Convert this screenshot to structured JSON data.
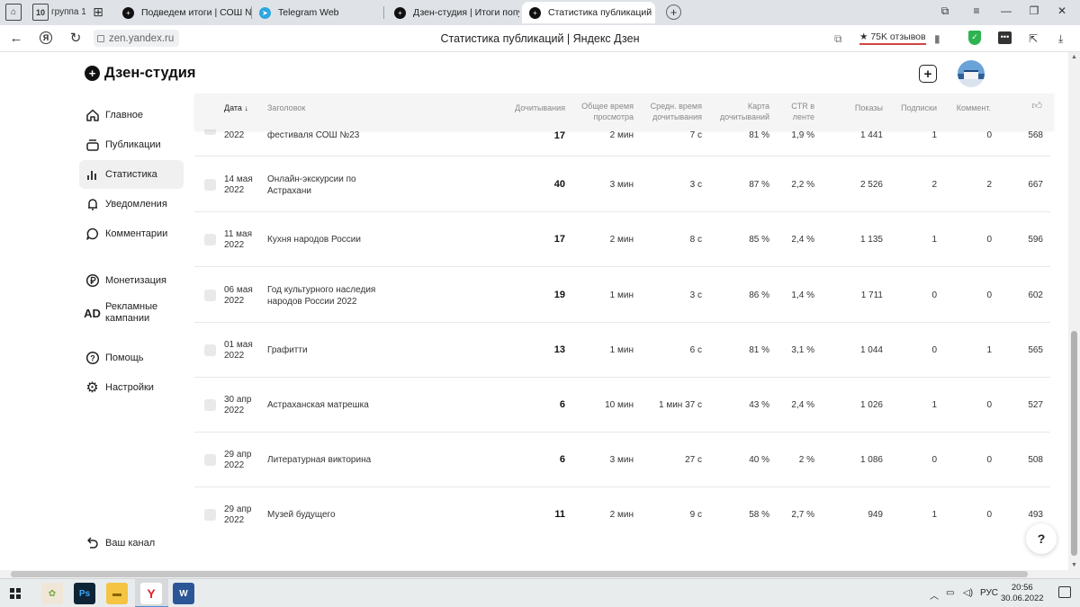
{
  "tabstrip": {
    "tab_count": "10",
    "group_label": "группа 1",
    "tabs": [
      {
        "title": "Подведем итоги | СОШ №",
        "favicon": "zen-icon"
      },
      {
        "title": "Telegram Web",
        "favicon": "telegram-icon"
      },
      {
        "title": "Дзен-студия | Итоги попул",
        "favicon": "zen-icon"
      },
      {
        "title": "Статистика публикаций",
        "favicon": "zen-icon"
      }
    ]
  },
  "addressbar": {
    "url": "zen.yandex.ru",
    "page_title": "Статистика публикаций | Яндекс Дзен",
    "reviews": "★ 75K отзывов"
  },
  "header": {
    "logo_text": "Дзен-студия"
  },
  "sidebar": {
    "items": [
      {
        "label": "Главное",
        "icon": "home-icon"
      },
      {
        "label": "Публикации",
        "icon": "publications-icon"
      },
      {
        "label": "Статистика",
        "icon": "stats-icon"
      },
      {
        "label": "Уведомления",
        "icon": "bell-icon"
      },
      {
        "label": "Комментарии",
        "icon": "comment-icon"
      },
      {
        "label": "Монетизация",
        "icon": "ruble-icon"
      },
      {
        "label": "Рекламные кампании",
        "icon": "ad-icon"
      },
      {
        "label": "Помощь",
        "icon": "help-icon"
      },
      {
        "label": "Настройки",
        "icon": "gear-icon"
      }
    ],
    "channel_label": "Ваш канал"
  },
  "table": {
    "headers": {
      "date": "Дата",
      "title": "Заголовок",
      "reads": "Дочитывания",
      "total_time": "Общее время просмотра",
      "avg_time": "Средн. время дочитывания",
      "map": "Карта дочитываний",
      "ctr": "CTR в ленте",
      "views": "Показы",
      "subs": "Подписки",
      "comments": "Коммент."
    },
    "partial_row": {
      "date": "2022",
      "title": "фестиваля СОШ №23",
      "reads": "17",
      "total_time": "2 мин",
      "avg_time": "7 с",
      "map": "81 %",
      "ctr": "1,9 %",
      "views": "1 441",
      "subs": "1",
      "comments": "0",
      "likes": "568"
    },
    "rows": [
      {
        "date1": "14 мая",
        "date2": "2022",
        "title1": "Онлайн-экскурсии по",
        "title2": "Астрахани",
        "reads": "40",
        "total_time": "3 мин",
        "avg_time": "3 с",
        "map": "87 %",
        "ctr": "2,2 %",
        "views": "2 526",
        "subs": "2",
        "comments": "2",
        "likes": "667"
      },
      {
        "date1": "11 мая",
        "date2": "2022",
        "title1": "Кухня народов России",
        "title2": "",
        "reads": "17",
        "total_time": "2 мин",
        "avg_time": "8 с",
        "map": "85 %",
        "ctr": "2,4 %",
        "views": "1 135",
        "subs": "1",
        "comments": "0",
        "likes": "596"
      },
      {
        "date1": "06 мая",
        "date2": "2022",
        "title1": "Год культурного наследия",
        "title2": "народов России 2022",
        "reads": "19",
        "total_time": "1 мин",
        "avg_time": "3 с",
        "map": "86 %",
        "ctr": "1,4 %",
        "views": "1 711",
        "subs": "0",
        "comments": "0",
        "likes": "602"
      },
      {
        "date1": "01 мая",
        "date2": "2022",
        "title1": "Графитти",
        "title2": "",
        "reads": "13",
        "total_time": "1 мин",
        "avg_time": "6 с",
        "map": "81 %",
        "ctr": "3,1 %",
        "views": "1 044",
        "subs": "0",
        "comments": "1",
        "likes": "565"
      },
      {
        "date1": "30 апр",
        "date2": "2022",
        "title1": "Астраханская матрешка",
        "title2": "",
        "reads": "6",
        "total_time": "10 мин",
        "avg_time": "1 мин 37 с",
        "map": "43 %",
        "ctr": "2,4 %",
        "views": "1 026",
        "subs": "1",
        "comments": "0",
        "likes": "527"
      },
      {
        "date1": "29 апр",
        "date2": "2022",
        "title1": "Литературная викторина",
        "title2": "",
        "reads": "6",
        "total_time": "3 мин",
        "avg_time": "27 с",
        "map": "40 %",
        "ctr": "2 %",
        "views": "1 086",
        "subs": "0",
        "comments": "0",
        "likes": "508"
      },
      {
        "date1": "29 апр",
        "date2": "2022",
        "title1": "Музей будущего",
        "title2": "",
        "reads": "11",
        "total_time": "2 мин",
        "avg_time": "9 с",
        "map": "58 %",
        "ctr": "2,7 %",
        "views": "949",
        "subs": "1",
        "comments": "0",
        "likes": "493"
      }
    ]
  },
  "help_button": "?",
  "taskbar": {
    "language": "РУС",
    "time": "20:56",
    "date": "30.06.2022"
  }
}
